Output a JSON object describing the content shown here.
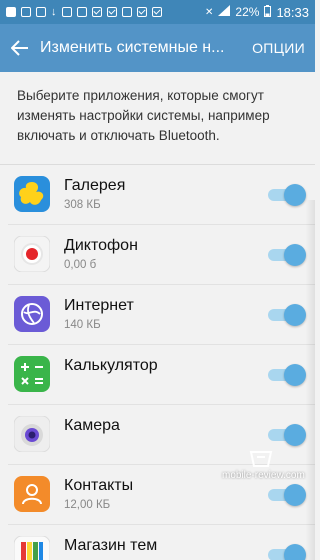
{
  "status_bar": {
    "battery": "22%",
    "time": "18:33"
  },
  "app_bar": {
    "title": "Изменить системные н...",
    "options_label": "ОПЦИИ"
  },
  "description": "Выберите приложения, которые смогут изменять настройки системы, например включать и отключать Bluetooth.",
  "apps": [
    {
      "name": "Галерея",
      "size": "308 КБ",
      "icon": "gallery-icon",
      "enabled": true
    },
    {
      "name": "Диктофон",
      "size": "0,00 б",
      "icon": "voice-recorder-icon",
      "enabled": true
    },
    {
      "name": "Интернет",
      "size": "140 КБ",
      "icon": "internet-icon",
      "enabled": true
    },
    {
      "name": "Калькулятор",
      "size": "",
      "icon": "calculator-icon",
      "enabled": true
    },
    {
      "name": "Камера",
      "size": "",
      "icon": "camera-icon",
      "enabled": true
    },
    {
      "name": "Контакты",
      "size": "12,00 КБ",
      "icon": "contacts-icon",
      "enabled": true
    },
    {
      "name": "Магазин тем",
      "size": "",
      "icon": "theme-store-icon",
      "enabled": true
    }
  ],
  "watermark": "mobile-review.com",
  "colors": {
    "status_bar": "#3f86b8",
    "app_bar": "#5394c7",
    "toggle_on": "#5aace0"
  }
}
